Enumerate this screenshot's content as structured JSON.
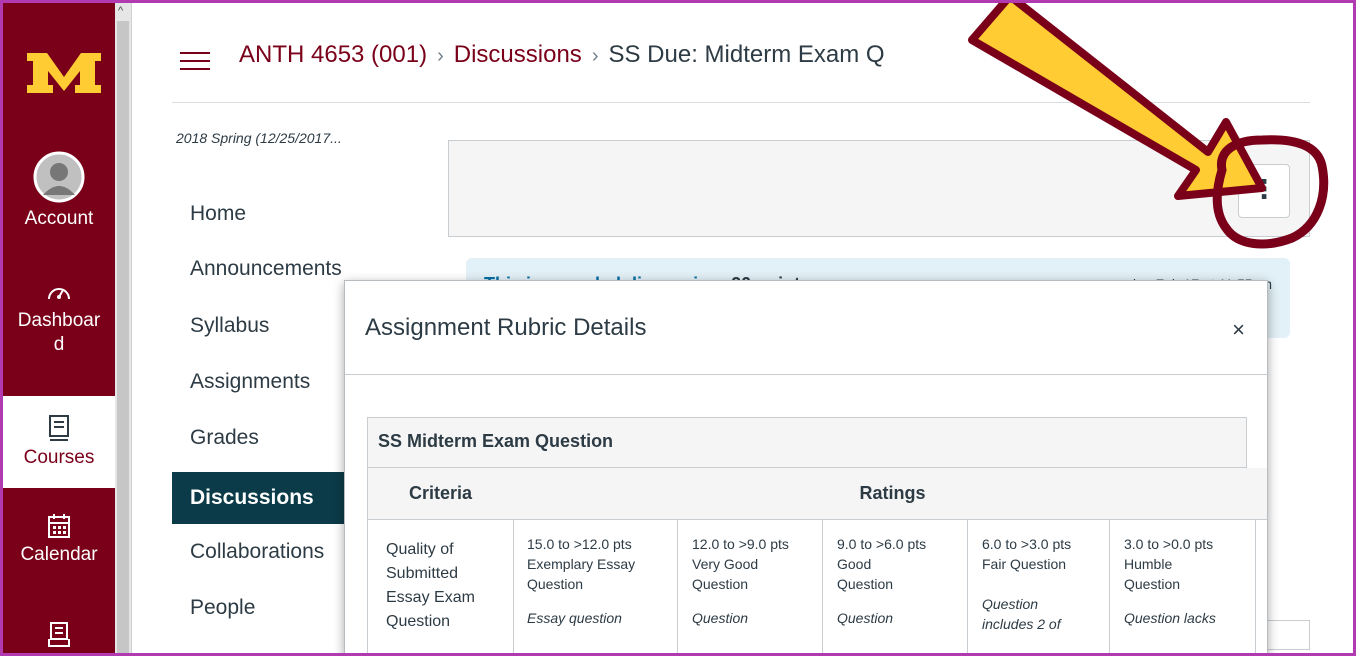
{
  "global_nav": {
    "logo": "M",
    "items": [
      {
        "label": "Account",
        "icon": "account-avatar-icon"
      },
      {
        "label": "Dashboar\nd",
        "icon": "dashboard-icon"
      },
      {
        "label": "Courses",
        "icon": "courses-icon"
      },
      {
        "label": "Calendar",
        "icon": "calendar-icon"
      },
      {
        "label": "",
        "icon": "inbox-icon"
      }
    ]
  },
  "breadcrumb": {
    "course": "ANTH 4653 (001)",
    "section": "Discussions",
    "current": "SS Due: Midterm Exam Q",
    "separator": "›"
  },
  "course_nav": {
    "term": "2018 Spring (12/25/2017...",
    "items": [
      "Home",
      "Announcements",
      "Syllabus",
      "Assignments",
      "Grades",
      "Discussions",
      "Collaborations",
      "People"
    ],
    "active": "Discussions"
  },
  "discussion": {
    "kebab": "⋮",
    "graded_text": "This is a graded discussion:",
    "points": "20 points",
    "due": "due Feb 17 at 11:55pm"
  },
  "modal": {
    "title": "Assignment Rubric Details",
    "close": "×",
    "rubric_title": "SS Midterm Exam Question",
    "criteria_header": "Criteria",
    "ratings_header": "Ratings",
    "criterion": [
      "Quality of",
      "Submitted",
      "Essay Exam",
      "Question"
    ],
    "ratings": [
      {
        "pts": "15.0 to >12.0 pts",
        "desc": [
          "Exemplary Essay",
          "Question"
        ],
        "long": "Essay question"
      },
      {
        "pts": "12.0 to >9.0 pts",
        "desc": [
          "Very Good",
          "Question"
        ],
        "long": "Question"
      },
      {
        "pts": "9.0 to >6.0 pts",
        "desc": [
          "Good",
          "Question"
        ],
        "long": "Question"
      },
      {
        "pts": "6.0 to >3.0 pts",
        "desc": [
          "Fair Question"
        ],
        "long": "Question\nincludes 2 of"
      },
      {
        "pts": "3.0 to >0.0 pts",
        "desc": [
          "Humble",
          "Question"
        ],
        "long": "Question lacks"
      }
    ]
  },
  "colors": {
    "maroon": "#7a0019",
    "gold": "#ffcc33",
    "active_nav": "#0b3b48",
    "annotation": "#7a0019"
  }
}
